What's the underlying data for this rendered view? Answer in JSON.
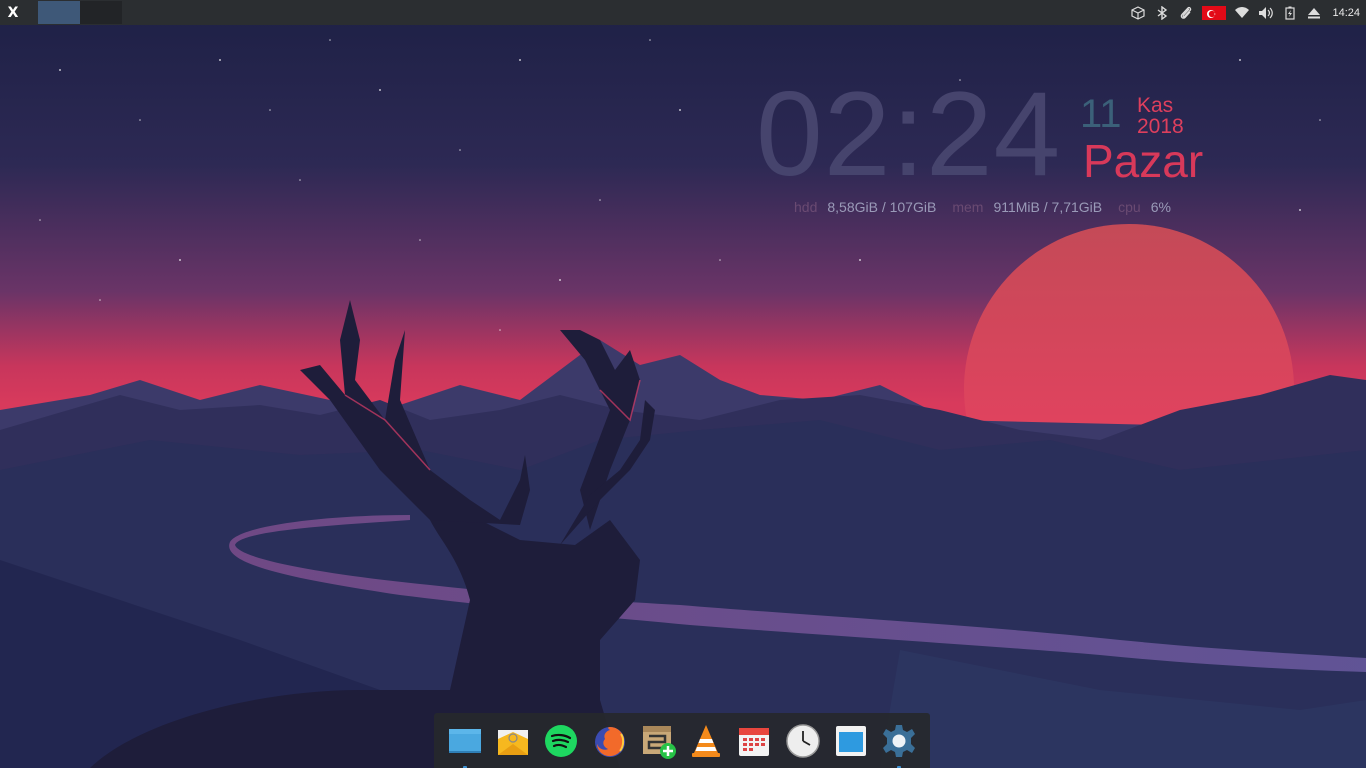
{
  "panel": {
    "menu_label": "X",
    "workspaces": [
      {
        "active": true
      },
      {
        "active": false
      }
    ],
    "tray_icons": [
      "package-updates-icon",
      "bluetooth-icon",
      "paperclip-icon",
      "turkey-flag-keyboard-icon",
      "wifi-icon",
      "volume-icon",
      "battery-icon",
      "eject-icon"
    ],
    "clock": "14:24"
  },
  "conky": {
    "time": "02:24",
    "day": "11",
    "month_year": "Kas 2018",
    "weekday": "Pazar",
    "stats": {
      "hdd_label": "hdd",
      "hdd_value": "8,58GiB / 107GiB",
      "mem_label": "mem",
      "mem_value": "911MiB / 7,71GiB",
      "cpu_label": "cpu",
      "cpu_value": "6%"
    }
  },
  "dock": {
    "items": [
      {
        "name": "files-icon",
        "running": true
      },
      {
        "name": "mail-icon",
        "running": false
      },
      {
        "name": "spotify-icon",
        "running": false
      },
      {
        "name": "firefox-icon",
        "running": false
      },
      {
        "name": "software-install-icon",
        "running": false
      },
      {
        "name": "vlc-icon",
        "running": false
      },
      {
        "name": "calendar-icon",
        "running": false
      },
      {
        "name": "clock-icon",
        "running": false
      },
      {
        "name": "window-icon",
        "running": false
      },
      {
        "name": "settings-icon",
        "running": true
      }
    ]
  },
  "colors": {
    "panel_bg": "#2b2e31",
    "accent": "#3d8fd0",
    "sun": "#e8365a",
    "conky_time": "#46446d",
    "conky_weekday": "#d8395a"
  }
}
